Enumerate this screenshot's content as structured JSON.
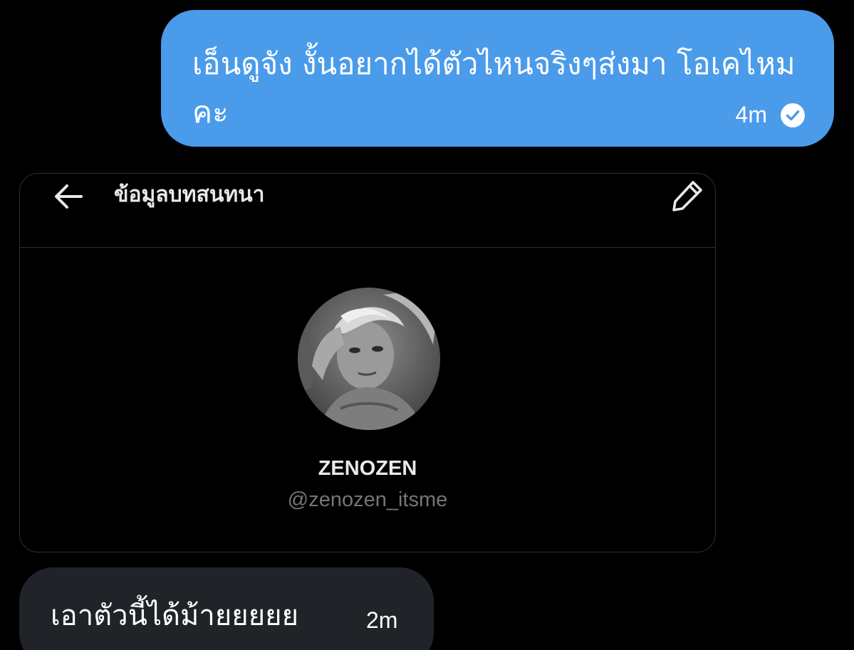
{
  "messages": {
    "outgoing": {
      "text": "เอ็นดูจัง งั้นอยากได้ตัวไหนจริงๆส่งมา โอเคไหมคะ",
      "time": "4m",
      "status_icon": "check-circle-icon"
    },
    "incoming": {
      "text": "เอาตัวนี้ได้ม้ายยยยย",
      "time": "2m"
    }
  },
  "card": {
    "title": "ข้อมูลบทสนทนา",
    "back_icon": "arrow-left-icon",
    "edit_icon": "pencil-icon",
    "profile": {
      "name": "ZENOZEN",
      "handle": "@zenozen_itsme"
    }
  },
  "colors": {
    "background": "#000000",
    "outgoing_bubble": "#4a9bea",
    "incoming_bubble": "#202327",
    "card_border": "#2f2f2f",
    "primary_text": "#e7e9ea",
    "secondary_text": "#71767b"
  }
}
